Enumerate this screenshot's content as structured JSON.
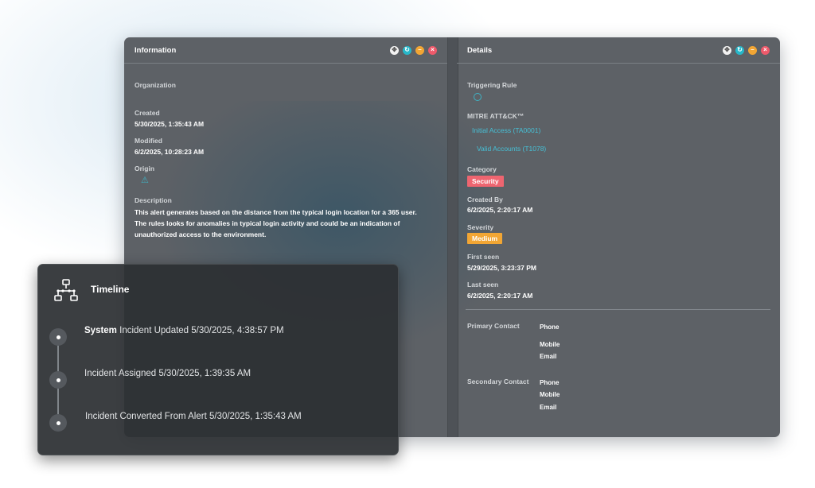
{
  "info_panel": {
    "title": "Information",
    "organization_label": "Organization",
    "created_label": "Created",
    "created_value": "5/30/2025, 1:35:43 AM",
    "modified_label": "Modified",
    "modified_value": "6/2/2025, 10:28:23 AM",
    "origin_label": "Origin",
    "origin_icon": "warning-triangle-icon",
    "description_label": "Description",
    "description_lines": [
      "This alert generates based on the distance from the typical login location for a 365 user.",
      "The rules looks for anomalies in typical login activity and could be an indication of",
      "unauthorized access to the environment."
    ]
  },
  "details_panel": {
    "title": "Details",
    "triggering_rule_label": "Triggering Rule",
    "mitre_label": "MITRE ATT&CK™",
    "mitre_tactic": "Initial Access (TA0001)",
    "mitre_technique": "Valid Accounts (T1078)",
    "category_label": "Category",
    "category_value": "Security",
    "created_by_label": "Created By",
    "created_by_value": "6/2/2025, 2:20:17 AM",
    "severity_label": "Severity",
    "severity_value": "Medium",
    "first_seen_label": "First seen",
    "first_seen_value": "5/29/2025, 3:23:37 PM",
    "last_seen_label": "Last seen",
    "last_seen_value": "6/2/2025, 2:20:17 AM",
    "primary_contact_label": "Primary Contact",
    "secondary_contact_label": "Secondary Contact",
    "phone_label": "Phone",
    "mobile_label": "Mobile",
    "email_label": "Email"
  },
  "window_controls": {
    "move": "✥",
    "refresh": "↻",
    "minimize": "–",
    "close": "×"
  },
  "timeline": {
    "title": "Timeline",
    "icon": "network-diagram-icon",
    "events": [
      {
        "actor": "System",
        "text": "Incident Updated 5/30/2025, 4:38:57 PM"
      },
      {
        "actor": "",
        "text": "Incident Assigned 5/30/2025, 1:39:35 AM"
      },
      {
        "actor": "",
        "text": "Incident Converted From Alert 5/30/2025, 1:35:43 AM"
      }
    ]
  },
  "colors": {
    "panel_bg": "#5d6166",
    "accent_teal": "#46c0d6",
    "security_badge": "#ee6570",
    "medium_badge": "#f2a634",
    "close_button": "#ee5a6b",
    "minimize_button": "#f2a634",
    "refresh_button": "#27b7c9"
  }
}
